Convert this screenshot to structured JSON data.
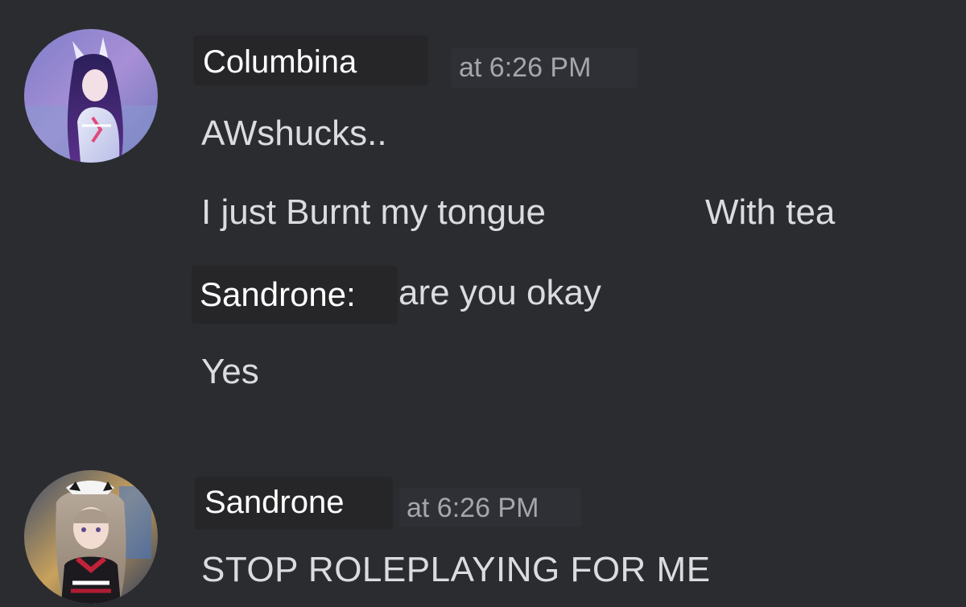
{
  "messages": [
    {
      "author": "Columbina",
      "timestamp": "at 6:26 PM",
      "avatar": "columbina-avatar",
      "lines": [
        "AWshucks..",
        "I just Burnt my tongue",
        "With tea",
        "are you okay",
        "Yes"
      ],
      "inline_speaker": "Sandrone:"
    },
    {
      "author": "Sandrone",
      "timestamp": "at 6:26 PM",
      "avatar": "sandrone-avatar",
      "lines": [
        "STOP ROLEPLAYING FOR ME"
      ]
    }
  ],
  "colors": {
    "background": "#2b2c30",
    "username": "#ffffff",
    "timestamp": "#a3a6ad",
    "message_text": "#dadce0"
  }
}
